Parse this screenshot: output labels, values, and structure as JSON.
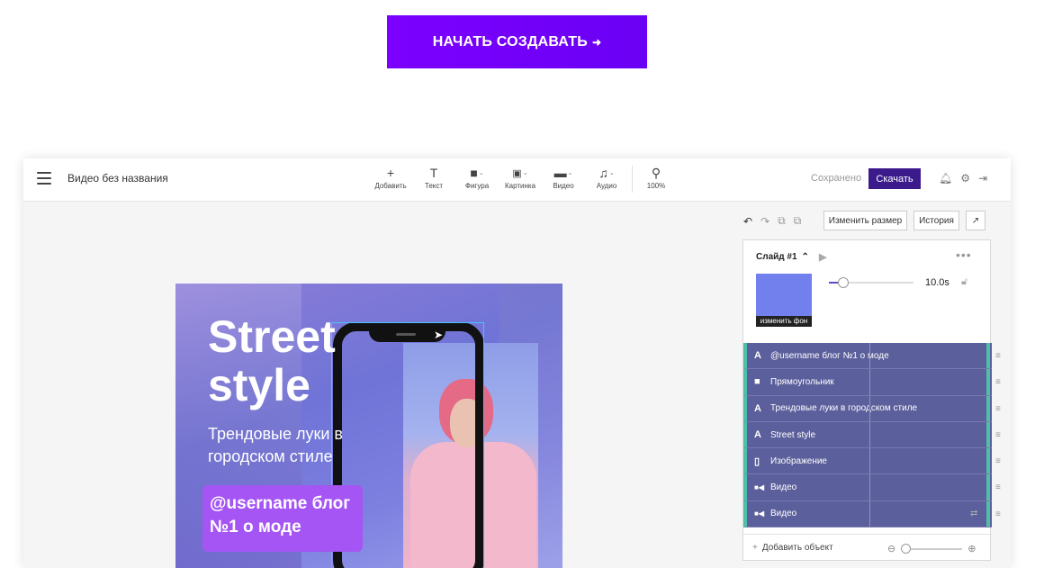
{
  "cta": {
    "label": "НАЧАТЬ СОЗДАВАТЬ",
    "arrow": "➜"
  },
  "editor": {
    "doc_title": "Видео без названия",
    "toolbar": [
      {
        "icon": "plus-icon",
        "glyph": "+",
        "label": "Добавить"
      },
      {
        "icon": "text-icon",
        "glyph": "T",
        "label": "Текст"
      },
      {
        "icon": "shape-icon",
        "glyph": "■",
        "label": "Фигура"
      },
      {
        "icon": "image-icon",
        "glyph": "🖼",
        "label": "Картинка"
      },
      {
        "icon": "video-icon",
        "glyph": "▬",
        "label": "Видео"
      },
      {
        "icon": "audio-icon",
        "glyph": "♫",
        "label": "Аудио"
      },
      {
        "icon": "zoom-icon",
        "glyph": "⚲",
        "label": "100%"
      }
    ],
    "saved_status": "Сохранено",
    "download_label": "Скачать",
    "resize_label": "Изменить размер",
    "history_label": "История"
  },
  "canvas": {
    "title": "Street style",
    "subtitle": "Трендовые луки в городском стиле",
    "badge": "@username блог №1 о моде"
  },
  "slide_panel": {
    "slide_title": "Слайд #1",
    "change_bg_label": "изменить фон",
    "duration": "10.0s",
    "layers": [
      {
        "icon": "A",
        "label": "@username блог №1 о моде"
      },
      {
        "icon": "■",
        "label": "Прямоугольник"
      },
      {
        "icon": "A",
        "label": "Трендовые луки в городском стиле"
      },
      {
        "icon": "A",
        "label": "Street style"
      },
      {
        "icon": "▯",
        "label": "Изображение"
      },
      {
        "icon": "■◀",
        "label": "Видео"
      },
      {
        "icon": "■◀",
        "label": "Видео"
      }
    ],
    "add_object_label": "Добавить объект"
  },
  "colors": {
    "cta": "#7c00ff",
    "download": "#3b1a8c",
    "layer_bg": "#5b5f9b",
    "layer_accent": "#4fc0a8"
  }
}
